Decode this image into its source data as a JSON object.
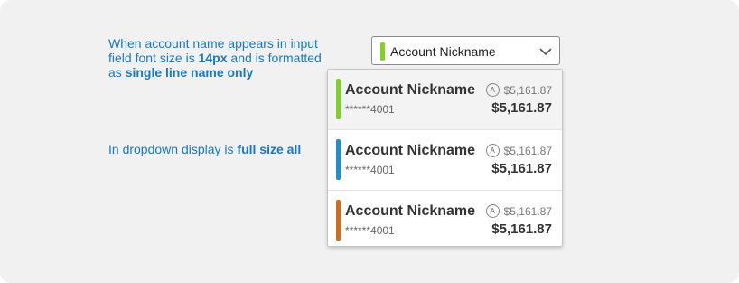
{
  "notes": {
    "note1_prefix": "When account name appears in input field font size is ",
    "note1_bold1": "14px",
    "note1_middle": " and is formatted as ",
    "note1_bold2": "single line name only",
    "note2_prefix": "In dropdown display is ",
    "note2_bold": "full size all"
  },
  "select": {
    "label": "Account Nickname",
    "color": "#7ed321",
    "icon": "chevron-down-icon"
  },
  "options": [
    {
      "name": "Account Nickname",
      "masked": "******4001",
      "available_icon": "A",
      "available": "$5,161.87",
      "balance": "$5,161.87",
      "color": "#7ed321",
      "selected": true
    },
    {
      "name": "Account Nickname",
      "masked": "******4001",
      "available_icon": "A",
      "available": "$5,161.87",
      "balance": "$5,161.87",
      "color": "#1b8fd0",
      "selected": false
    },
    {
      "name": "Account Nickname",
      "masked": "******4001",
      "available_icon": "A",
      "available": "$5,161.87",
      "balance": "$5,161.87",
      "color": "#d96b12",
      "selected": false
    }
  ]
}
